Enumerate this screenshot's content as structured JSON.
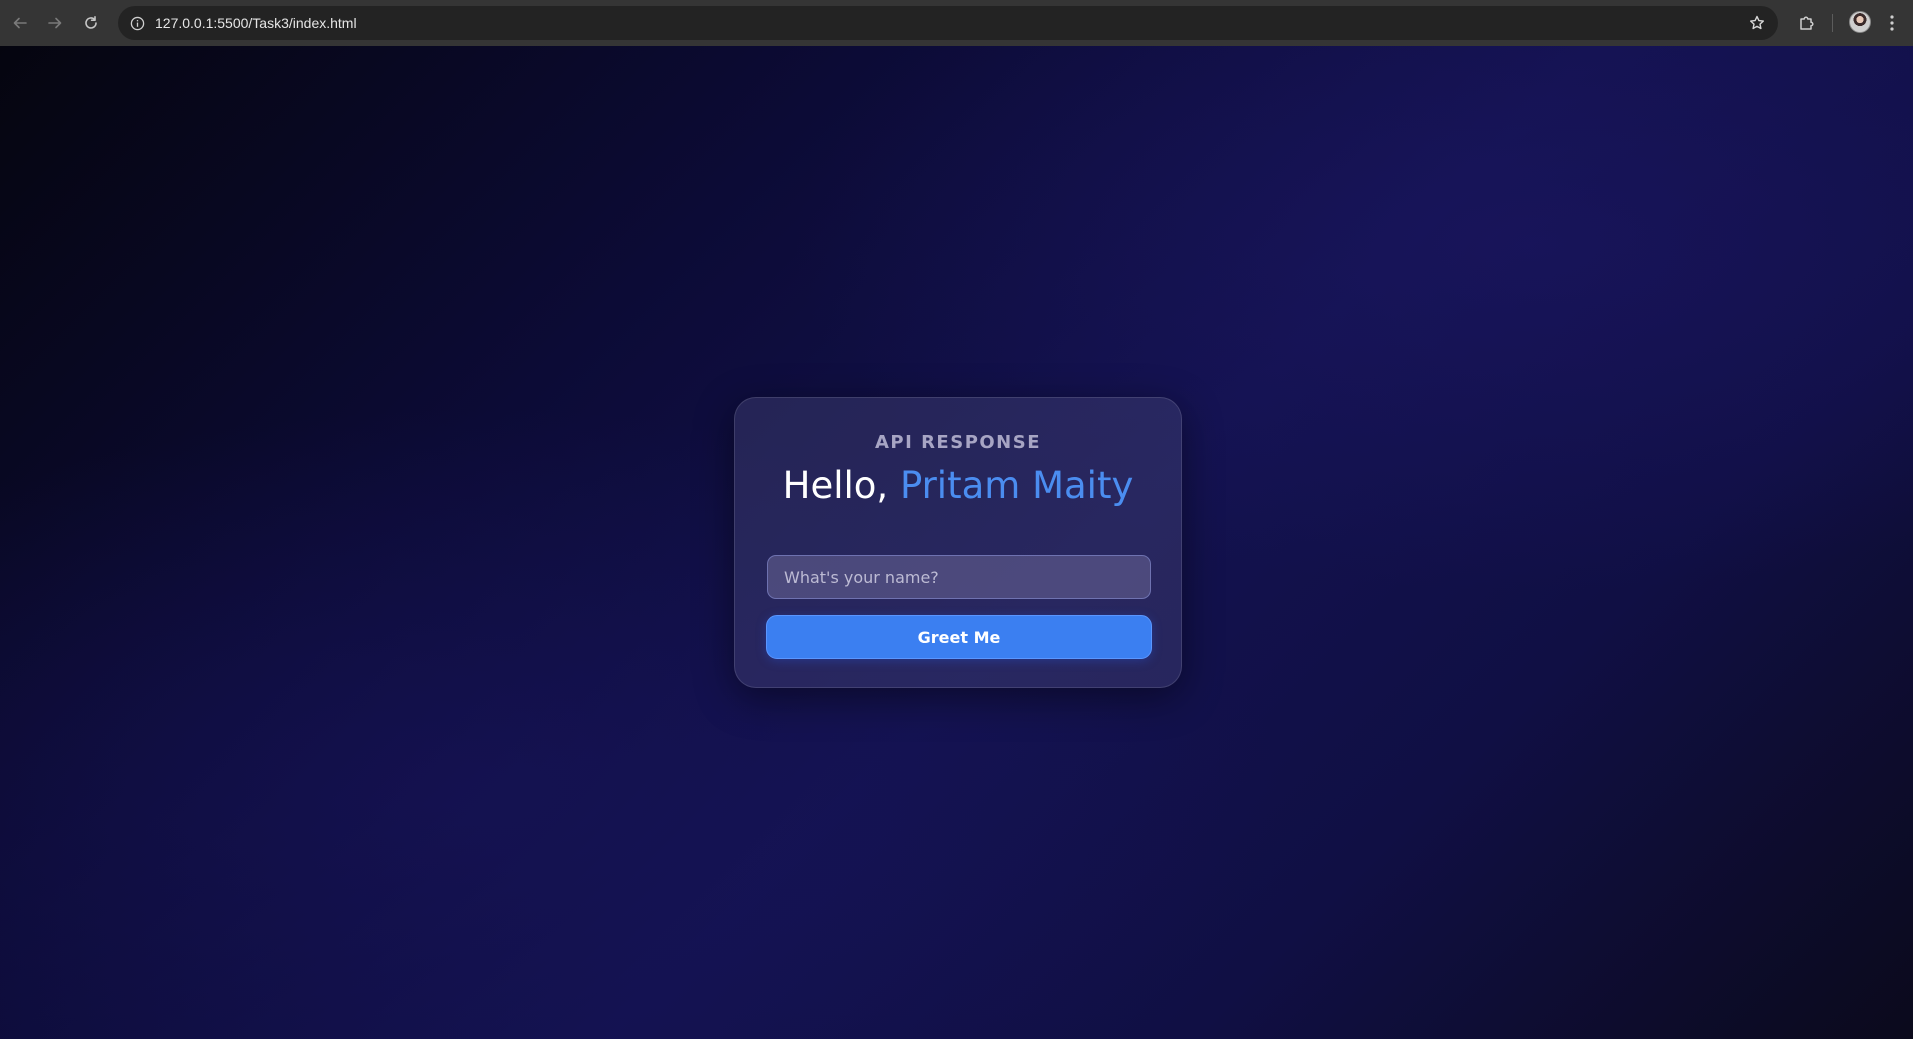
{
  "browser": {
    "url": "127.0.0.1:5500/Task3/index.html",
    "icons": {
      "back": "arrow-left-icon",
      "forward": "arrow-right-icon",
      "reload": "reload-icon",
      "site_info": "info-icon",
      "bookmark": "star-icon",
      "extensions": "puzzle-icon",
      "profile": "avatar",
      "menu": "kebab-menu-icon"
    }
  },
  "card": {
    "eyebrow": "API RESPONSE",
    "greeting_prefix": "Hello, ",
    "greeting_name": "Pritam Maity",
    "input": {
      "value": "",
      "placeholder": "What's your name?"
    },
    "button_label": "Greet Me"
  },
  "colors": {
    "accent": "#3b7ff1",
    "name_highlight": "#4b8df0",
    "background_dark": "#0c0b36"
  }
}
